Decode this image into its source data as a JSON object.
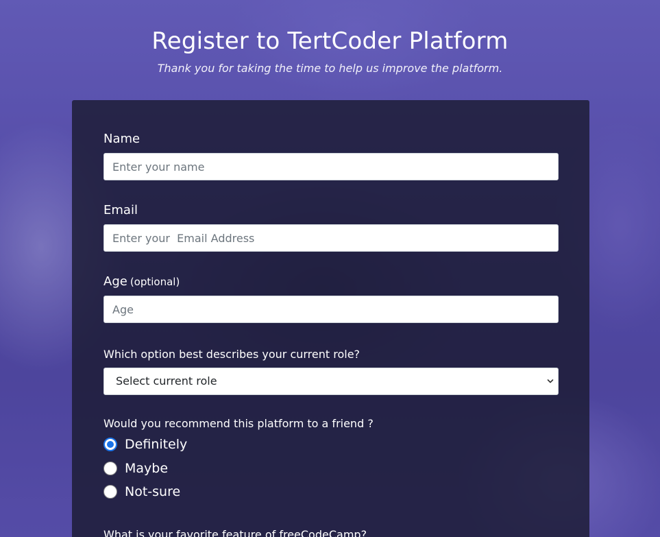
{
  "header": {
    "title": "Register to TertCoder Platform",
    "subtitle": "Thank you for taking the time to help us improve the platform."
  },
  "form": {
    "name": {
      "label": "Name",
      "placeholder": "Enter your name",
      "value": ""
    },
    "email": {
      "label": "Email",
      "placeholder": "Enter your  Email Address",
      "value": ""
    },
    "age": {
      "label": "Age",
      "optional_label": "(optional)",
      "placeholder": "Age",
      "value": ""
    },
    "role": {
      "label": "Which option best describes your current role?",
      "selected": "Select current role"
    },
    "recommend": {
      "label": "Would you recommend this platform to a friend ?",
      "options": [
        {
          "label": "Definitely",
          "checked": true
        },
        {
          "label": "Maybe",
          "checked": false
        },
        {
          "label": "Not-sure",
          "checked": false
        }
      ]
    },
    "favorite_feature": {
      "label": "What is your favorite feature of freeCodeCamp?"
    }
  },
  "colors": {
    "accent": "#1a73e8",
    "card_background": "#1b1b32",
    "page_tint": "#5b54a6"
  }
}
